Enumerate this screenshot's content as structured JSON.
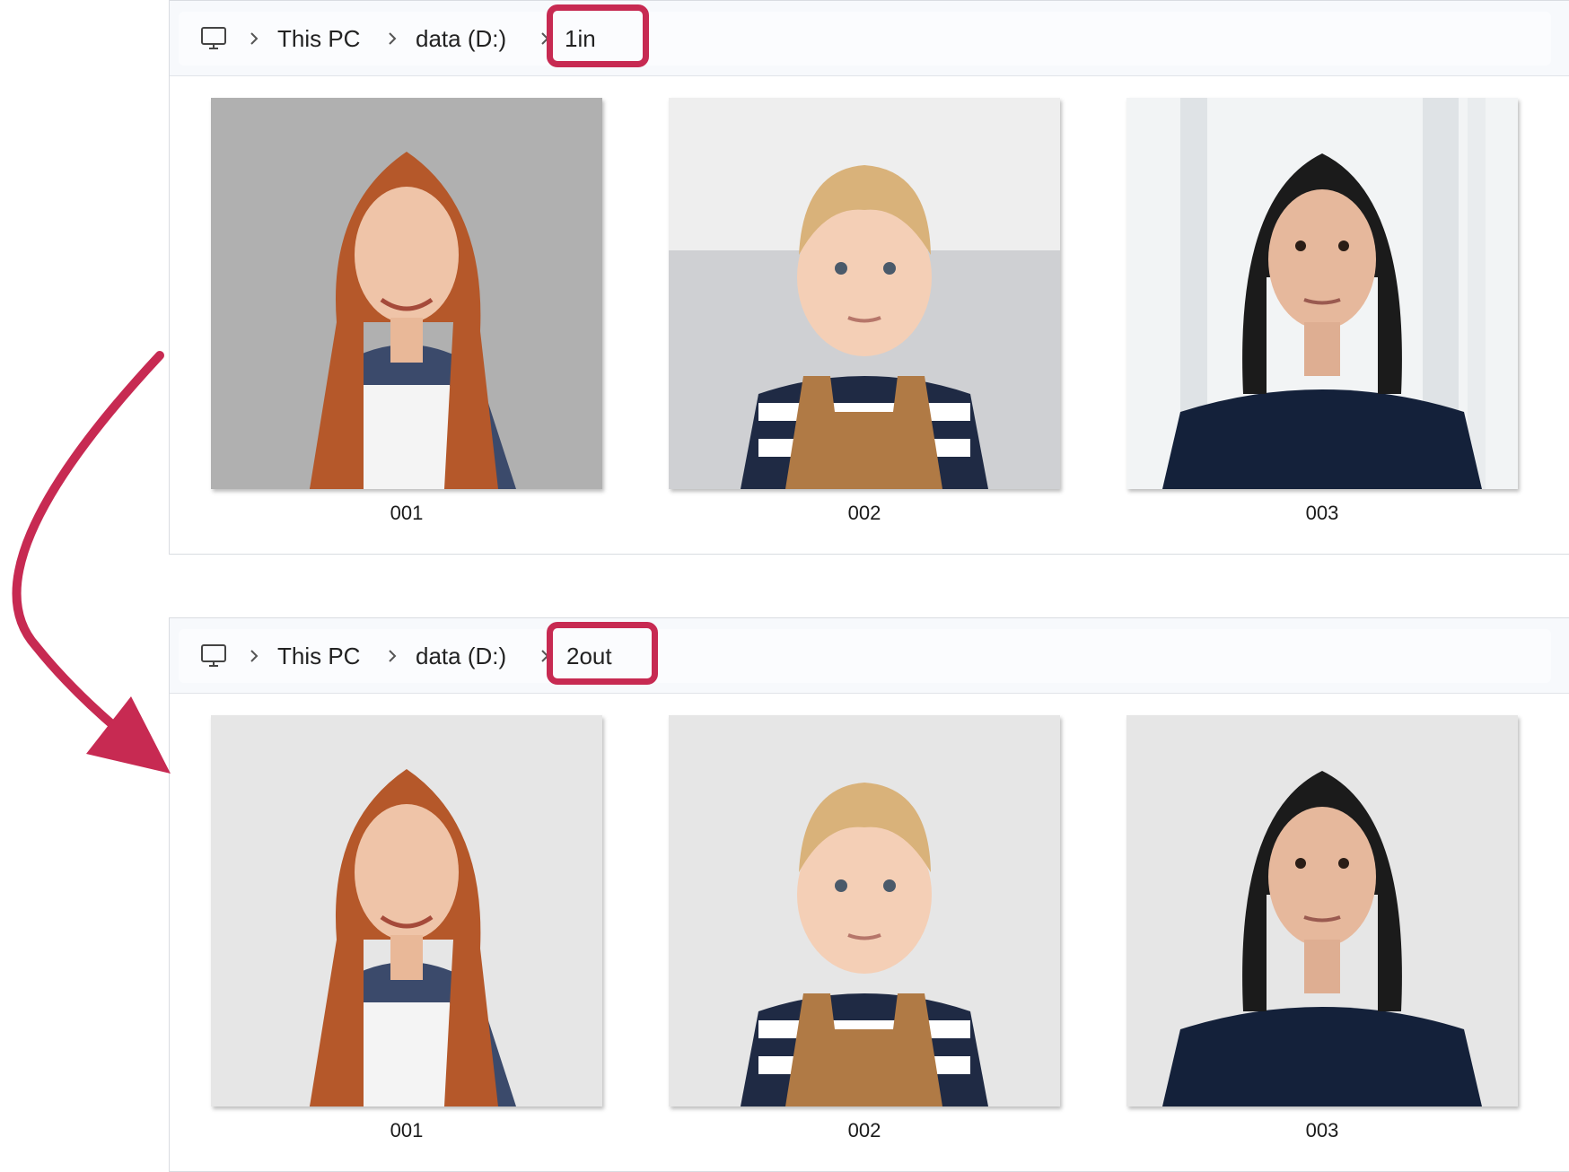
{
  "panels": [
    {
      "breadcrumb": {
        "root": "This PC",
        "drive": "data (D:)",
        "folder": "1in"
      },
      "files": [
        {
          "name": "001",
          "image": "portrait-redhead-woman-plaid-shirt"
        },
        {
          "name": "002",
          "image": "portrait-blond-toddler-overalls"
        },
        {
          "name": "003",
          "image": "portrait-dark-haired-woman-navy-blouse"
        }
      ]
    },
    {
      "breadcrumb": {
        "root": "This PC",
        "drive": "data (D:)",
        "folder": "2out"
      },
      "files": [
        {
          "name": "001",
          "image": "portrait-redhead-woman-plain-background"
        },
        {
          "name": "002",
          "image": "portrait-blond-toddler-plain-background"
        },
        {
          "name": "003",
          "image": "portrait-dark-haired-woman-plain-background"
        }
      ]
    }
  ],
  "icons": {
    "pc": "computer-monitor-icon",
    "separator": "chevron-right-icon"
  },
  "colors": {
    "highlight": "#c72a52",
    "arrow": "#c72a52",
    "plain_background": "#e6e6e6"
  }
}
